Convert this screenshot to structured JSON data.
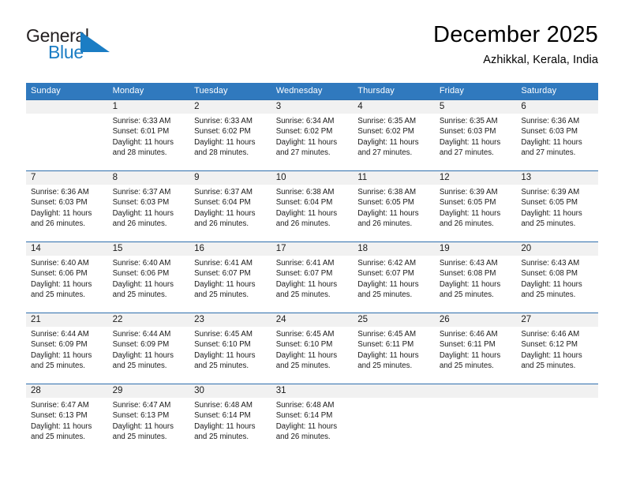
{
  "brand": {
    "word_general": "General",
    "word_blue": "Blue",
    "triangle_color": "#1b7dc4"
  },
  "header": {
    "title": "December 2025",
    "subtitle": "Azhikkal, Kerala, India"
  },
  "theme": {
    "header_blue": "#3079be",
    "row_line_blue": "#2f6fad",
    "daynum_band_gray": "#f1f1f1"
  },
  "weekday_headers": [
    "Sunday",
    "Monday",
    "Tuesday",
    "Wednesday",
    "Thursday",
    "Friday",
    "Saturday"
  ],
  "labels": {
    "sunrise_prefix": "Sunrise:",
    "sunset_prefix": "Sunset:",
    "daylight_prefix": "Daylight:"
  },
  "weeks": [
    [
      {
        "day": "",
        "sunrise": "",
        "sunset": "",
        "daylight_line1": "",
        "daylight_line2": "",
        "empty": true
      },
      {
        "day": "1",
        "sunrise": "Sunrise: 6:33 AM",
        "sunset": "Sunset: 6:01 PM",
        "daylight_line1": "Daylight: 11 hours",
        "daylight_line2": "and 28 minutes."
      },
      {
        "day": "2",
        "sunrise": "Sunrise: 6:33 AM",
        "sunset": "Sunset: 6:02 PM",
        "daylight_line1": "Daylight: 11 hours",
        "daylight_line2": "and 28 minutes."
      },
      {
        "day": "3",
        "sunrise": "Sunrise: 6:34 AM",
        "sunset": "Sunset: 6:02 PM",
        "daylight_line1": "Daylight: 11 hours",
        "daylight_line2": "and 27 minutes."
      },
      {
        "day": "4",
        "sunrise": "Sunrise: 6:35 AM",
        "sunset": "Sunset: 6:02 PM",
        "daylight_line1": "Daylight: 11 hours",
        "daylight_line2": "and 27 minutes."
      },
      {
        "day": "5",
        "sunrise": "Sunrise: 6:35 AM",
        "sunset": "Sunset: 6:03 PM",
        "daylight_line1": "Daylight: 11 hours",
        "daylight_line2": "and 27 minutes."
      },
      {
        "day": "6",
        "sunrise": "Sunrise: 6:36 AM",
        "sunset": "Sunset: 6:03 PM",
        "daylight_line1": "Daylight: 11 hours",
        "daylight_line2": "and 27 minutes."
      }
    ],
    [
      {
        "day": "7",
        "sunrise": "Sunrise: 6:36 AM",
        "sunset": "Sunset: 6:03 PM",
        "daylight_line1": "Daylight: 11 hours",
        "daylight_line2": "and 26 minutes."
      },
      {
        "day": "8",
        "sunrise": "Sunrise: 6:37 AM",
        "sunset": "Sunset: 6:03 PM",
        "daylight_line1": "Daylight: 11 hours",
        "daylight_line2": "and 26 minutes."
      },
      {
        "day": "9",
        "sunrise": "Sunrise: 6:37 AM",
        "sunset": "Sunset: 6:04 PM",
        "daylight_line1": "Daylight: 11 hours",
        "daylight_line2": "and 26 minutes."
      },
      {
        "day": "10",
        "sunrise": "Sunrise: 6:38 AM",
        "sunset": "Sunset: 6:04 PM",
        "daylight_line1": "Daylight: 11 hours",
        "daylight_line2": "and 26 minutes."
      },
      {
        "day": "11",
        "sunrise": "Sunrise: 6:38 AM",
        "sunset": "Sunset: 6:05 PM",
        "daylight_line1": "Daylight: 11 hours",
        "daylight_line2": "and 26 minutes."
      },
      {
        "day": "12",
        "sunrise": "Sunrise: 6:39 AM",
        "sunset": "Sunset: 6:05 PM",
        "daylight_line1": "Daylight: 11 hours",
        "daylight_line2": "and 26 minutes."
      },
      {
        "day": "13",
        "sunrise": "Sunrise: 6:39 AM",
        "sunset": "Sunset: 6:05 PM",
        "daylight_line1": "Daylight: 11 hours",
        "daylight_line2": "and 25 minutes."
      }
    ],
    [
      {
        "day": "14",
        "sunrise": "Sunrise: 6:40 AM",
        "sunset": "Sunset: 6:06 PM",
        "daylight_line1": "Daylight: 11 hours",
        "daylight_line2": "and 25 minutes."
      },
      {
        "day": "15",
        "sunrise": "Sunrise: 6:40 AM",
        "sunset": "Sunset: 6:06 PM",
        "daylight_line1": "Daylight: 11 hours",
        "daylight_line2": "and 25 minutes."
      },
      {
        "day": "16",
        "sunrise": "Sunrise: 6:41 AM",
        "sunset": "Sunset: 6:07 PM",
        "daylight_line1": "Daylight: 11 hours",
        "daylight_line2": "and 25 minutes."
      },
      {
        "day": "17",
        "sunrise": "Sunrise: 6:41 AM",
        "sunset": "Sunset: 6:07 PM",
        "daylight_line1": "Daylight: 11 hours",
        "daylight_line2": "and 25 minutes."
      },
      {
        "day": "18",
        "sunrise": "Sunrise: 6:42 AM",
        "sunset": "Sunset: 6:07 PM",
        "daylight_line1": "Daylight: 11 hours",
        "daylight_line2": "and 25 minutes."
      },
      {
        "day": "19",
        "sunrise": "Sunrise: 6:43 AM",
        "sunset": "Sunset: 6:08 PM",
        "daylight_line1": "Daylight: 11 hours",
        "daylight_line2": "and 25 minutes."
      },
      {
        "day": "20",
        "sunrise": "Sunrise: 6:43 AM",
        "sunset": "Sunset: 6:08 PM",
        "daylight_line1": "Daylight: 11 hours",
        "daylight_line2": "and 25 minutes."
      }
    ],
    [
      {
        "day": "21",
        "sunrise": "Sunrise: 6:44 AM",
        "sunset": "Sunset: 6:09 PM",
        "daylight_line1": "Daylight: 11 hours",
        "daylight_line2": "and 25 minutes."
      },
      {
        "day": "22",
        "sunrise": "Sunrise: 6:44 AM",
        "sunset": "Sunset: 6:09 PM",
        "daylight_line1": "Daylight: 11 hours",
        "daylight_line2": "and 25 minutes."
      },
      {
        "day": "23",
        "sunrise": "Sunrise: 6:45 AM",
        "sunset": "Sunset: 6:10 PM",
        "daylight_line1": "Daylight: 11 hours",
        "daylight_line2": "and 25 minutes."
      },
      {
        "day": "24",
        "sunrise": "Sunrise: 6:45 AM",
        "sunset": "Sunset: 6:10 PM",
        "daylight_line1": "Daylight: 11 hours",
        "daylight_line2": "and 25 minutes."
      },
      {
        "day": "25",
        "sunrise": "Sunrise: 6:45 AM",
        "sunset": "Sunset: 6:11 PM",
        "daylight_line1": "Daylight: 11 hours",
        "daylight_line2": "and 25 minutes."
      },
      {
        "day": "26",
        "sunrise": "Sunrise: 6:46 AM",
        "sunset": "Sunset: 6:11 PM",
        "daylight_line1": "Daylight: 11 hours",
        "daylight_line2": "and 25 minutes."
      },
      {
        "day": "27",
        "sunrise": "Sunrise: 6:46 AM",
        "sunset": "Sunset: 6:12 PM",
        "daylight_line1": "Daylight: 11 hours",
        "daylight_line2": "and 25 minutes."
      }
    ],
    [
      {
        "day": "28",
        "sunrise": "Sunrise: 6:47 AM",
        "sunset": "Sunset: 6:13 PM",
        "daylight_line1": "Daylight: 11 hours",
        "daylight_line2": "and 25 minutes."
      },
      {
        "day": "29",
        "sunrise": "Sunrise: 6:47 AM",
        "sunset": "Sunset: 6:13 PM",
        "daylight_line1": "Daylight: 11 hours",
        "daylight_line2": "and 25 minutes."
      },
      {
        "day": "30",
        "sunrise": "Sunrise: 6:48 AM",
        "sunset": "Sunset: 6:14 PM",
        "daylight_line1": "Daylight: 11 hours",
        "daylight_line2": "and 25 minutes."
      },
      {
        "day": "31",
        "sunrise": "Sunrise: 6:48 AM",
        "sunset": "Sunset: 6:14 PM",
        "daylight_line1": "Daylight: 11 hours",
        "daylight_line2": "and 26 minutes."
      },
      {
        "day": "",
        "sunrise": "",
        "sunset": "",
        "daylight_line1": "",
        "daylight_line2": "",
        "empty": true
      },
      {
        "day": "",
        "sunrise": "",
        "sunset": "",
        "daylight_line1": "",
        "daylight_line2": "",
        "empty": true
      },
      {
        "day": "",
        "sunrise": "",
        "sunset": "",
        "daylight_line1": "",
        "daylight_line2": "",
        "empty": true
      }
    ]
  ]
}
